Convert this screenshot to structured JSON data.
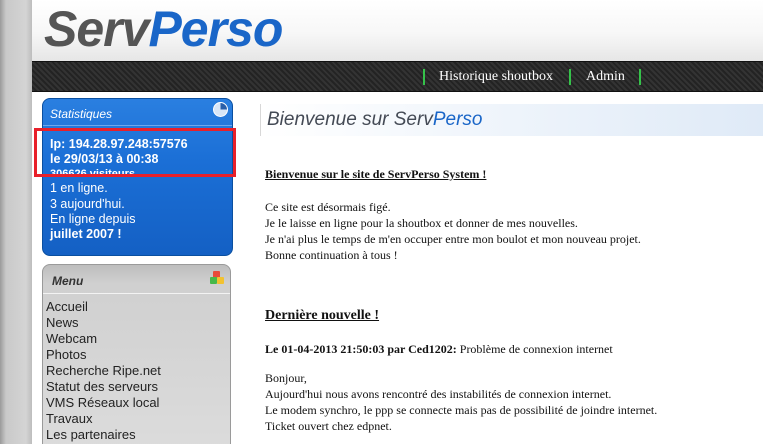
{
  "header": {
    "logo_part1": "Serv",
    "logo_part2": "Perso"
  },
  "nav": {
    "items": [
      {
        "label": "Historique shoutbox"
      },
      {
        "label": "Admin"
      }
    ]
  },
  "stats": {
    "title": "Statistiques",
    "ip_line": "Ip: 194.28.97.248:57576",
    "date_line": "le 29/03/13 à 00:38",
    "visitors_line": "306626 visiteurs",
    "online_line": "1 en ligne.",
    "today_line": "3 aujourd'hui.",
    "since_line": "En ligne depuis",
    "since_date": "juillet 2007 !"
  },
  "menu": {
    "title": "Menu",
    "items": [
      {
        "label": "Accueil"
      },
      {
        "label": "News"
      },
      {
        "label": "Webcam"
      },
      {
        "label": "Photos"
      },
      {
        "label": "Recherche Ripe.net"
      },
      {
        "label": "Statut des serveurs"
      },
      {
        "label": "VMS Réseaux local"
      },
      {
        "label": "Travaux"
      },
      {
        "label": "Les partenaires"
      }
    ]
  },
  "content": {
    "title_part1": "Bienvenue sur Serv",
    "title_part2": "Perso",
    "welcome_heading": "Bienvenue sur le site de ServPerso System !",
    "paragraph": [
      "Ce site est désormais figé.",
      "Je le laisse en ligne pour la shoutbox et donner de mes nouvelles.",
      "Je n'ai plus le temps de m'en occuper entre mon boulot et mon nouveau projet.",
      "Bonne continuation à tous !"
    ],
    "news_heading": "Dernière nouvelle !",
    "news_meta": "Le 01-04-2013 21:50:03 par Ced1202:",
    "news_subject": "Problème de connexion internet",
    "news_body": [
      "Bonjour,",
      "Aujourd'hui nous avons rencontré des instabilités de connexion internet.",
      "Le modem synchro, le ppp se connecte mais pas de possibilité de joindre internet.",
      "Ticket ouvert chez edpnet."
    ]
  },
  "colors": {
    "accent_blue": "#1a66c8",
    "nav_separator": "#35c24a",
    "highlight": "#e8202a"
  }
}
